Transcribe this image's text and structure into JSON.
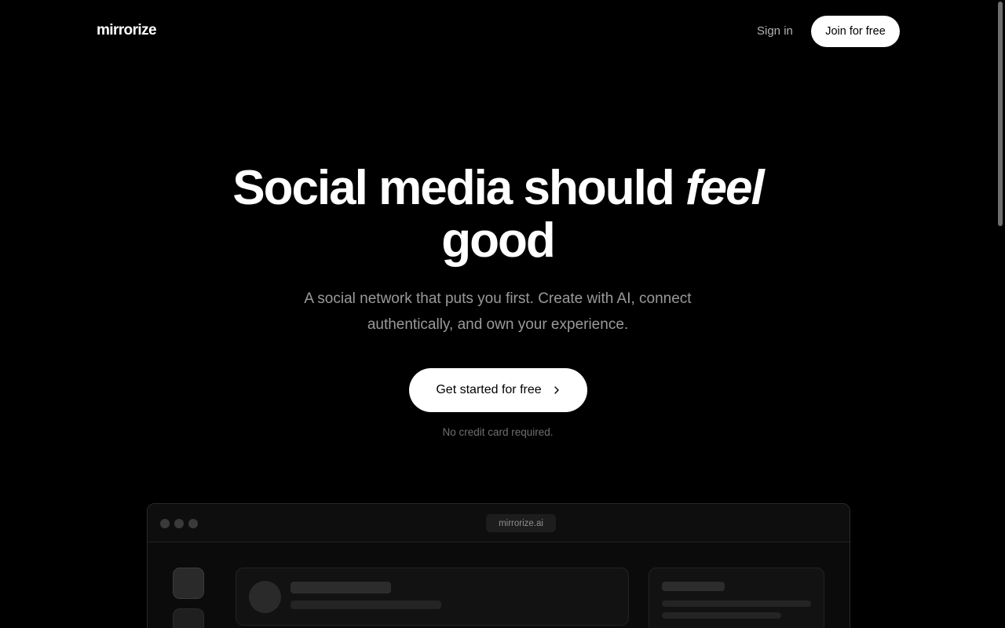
{
  "header": {
    "logo": "mirrorize",
    "signin_label": "Sign in",
    "join_label": "Join for free"
  },
  "hero": {
    "title_part1": "Social media should ",
    "title_em": "feel",
    "title_part2": "good",
    "subtitle": "A social network that puts you first. Create with AI, connect authentically, and own your experience.",
    "cta_label": "Get started for free",
    "note": "No credit card required."
  },
  "mock": {
    "url": "mirrorize.ai"
  },
  "colors": {
    "background": "#000000",
    "button_bg": "#ffffff",
    "button_text": "#000000",
    "muted_text": "#9a9a9a"
  }
}
